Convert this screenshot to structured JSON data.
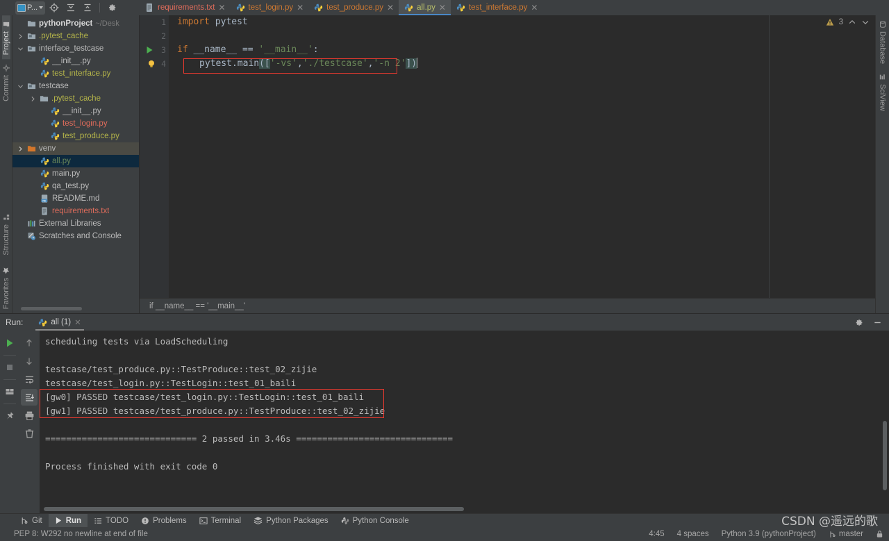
{
  "toolbar": {
    "project_selector_label": "P...",
    "buttons": [
      {
        "name": "project-selector",
        "label": "P..."
      },
      {
        "name": "locate-icon",
        "label": "Select Opened File"
      },
      {
        "name": "expand-all-icon",
        "label": "Expand All"
      },
      {
        "name": "collapse-all-icon",
        "label": "Collapse All"
      },
      {
        "name": "settings-gear-icon",
        "label": "Settings"
      }
    ]
  },
  "left_rail": {
    "top": "Project",
    "below": "Commit",
    "structure": "Structure",
    "favorites": "Favorites"
  },
  "right_rail": {
    "database": "Database",
    "sciview": "SciView"
  },
  "tabs": [
    {
      "label": "requirements.txt",
      "icon": "text-file-icon",
      "color": "red",
      "active": false
    },
    {
      "label": "test_login.py",
      "icon": "python-file-icon",
      "color": "orange",
      "active": false
    },
    {
      "label": "test_produce.py",
      "icon": "python-file-icon",
      "color": "orange",
      "active": false
    },
    {
      "label": "all.py",
      "icon": "python-file-icon",
      "color": "active",
      "active": true
    },
    {
      "label": "test_interface.py",
      "icon": "python-file-icon",
      "color": "orange",
      "active": false
    }
  ],
  "project_tree": [
    {
      "label": "pythonProject",
      "suffix": "~/Desk",
      "indent": 0,
      "arrow": "none",
      "icon": "folder-icon",
      "style": "bold",
      "selected": false
    },
    {
      "label": ".pytest_cache",
      "suffix": "",
      "indent": 1,
      "arrow": "right",
      "icon": "folder-module-icon",
      "style": "olive",
      "selected": false
    },
    {
      "label": "interface_testcase",
      "suffix": "",
      "indent": 1,
      "arrow": "down",
      "icon": "folder-module-icon",
      "style": "plain",
      "selected": false
    },
    {
      "label": "__init__.py",
      "suffix": "",
      "indent": 2,
      "arrow": "none",
      "icon": "python-file-icon",
      "style": "plain",
      "selected": false
    },
    {
      "label": "test_interface.py",
      "suffix": "",
      "indent": 2,
      "arrow": "none",
      "icon": "python-file-icon",
      "style": "olive",
      "selected": false
    },
    {
      "label": "testcase",
      "suffix": "",
      "indent": 1,
      "arrow": "down",
      "icon": "folder-module-icon",
      "style": "plain",
      "selected": false
    },
    {
      "label": ".pytest_cache",
      "suffix": "",
      "indent": 2,
      "arrow": "right",
      "icon": "folder-icon",
      "style": "olive",
      "selected": false
    },
    {
      "label": "__init__.py",
      "suffix": "",
      "indent": 3,
      "arrow": "none",
      "icon": "python-file-icon",
      "style": "plain",
      "selected": false
    },
    {
      "label": "test_login.py",
      "suffix": "",
      "indent": 3,
      "arrow": "none",
      "icon": "python-file-icon",
      "style": "red",
      "selected": false
    },
    {
      "label": "test_produce.py",
      "suffix": "",
      "indent": 3,
      "arrow": "none",
      "icon": "python-file-icon",
      "style": "olive",
      "selected": false
    },
    {
      "label": "venv",
      "suffix": "",
      "indent": 1,
      "arrow": "right",
      "icon": "folder-orange-icon",
      "style": "plain",
      "selected": false,
      "highlight": true
    },
    {
      "label": "all.py",
      "suffix": "",
      "indent": 2,
      "arrow": "none",
      "icon": "python-file-icon",
      "style": "green",
      "selected": true
    },
    {
      "label": "main.py",
      "suffix": "",
      "indent": 2,
      "arrow": "none",
      "icon": "python-file-icon",
      "style": "plain",
      "selected": false
    },
    {
      "label": "qa_test.py",
      "suffix": "",
      "indent": 2,
      "arrow": "none",
      "icon": "python-file-icon",
      "style": "plain",
      "selected": false
    },
    {
      "label": "README.md",
      "suffix": "",
      "indent": 2,
      "arrow": "none",
      "icon": "markdown-file-icon",
      "style": "plain",
      "selected": false
    },
    {
      "label": "requirements.txt",
      "suffix": "",
      "indent": 2,
      "arrow": "none",
      "icon": "text-file-icon",
      "style": "red",
      "selected": false
    },
    {
      "label": "External Libraries",
      "suffix": "",
      "indent": 0,
      "arrow": "none",
      "icon": "libraries-icon",
      "style": "plain",
      "selected": false
    },
    {
      "label": "Scratches and Console",
      "suffix": "",
      "indent": 0,
      "arrow": "none",
      "icon": "scratches-icon",
      "style": "plain",
      "selected": false
    }
  ],
  "editor": {
    "line_numbers": [
      "1",
      "2",
      "3",
      "4"
    ],
    "lines": [
      "import pytest",
      "",
      "if __name__ == '__main__':",
      "    pytest.main(['-vs','./testcase','-n 2'])"
    ],
    "code_tokens": {
      "l1_kw": "import",
      "l1_rest": " pytest",
      "l3_kw": "if",
      "l3_name": " __name__ ",
      "l3_eq": "== ",
      "l3_str": "'__main__'",
      "l3_colon": ":",
      "l4_obj": "pytest",
      "l4_dot": ".",
      "l4_fn": "main",
      "l4_open": "([",
      "l4_s1": "'-vs'",
      "l4_c1": ",",
      "l4_s2": "'./testcase'",
      "l4_c2": ",",
      "l4_s3": "'-n 2'",
      "l4_close": "])"
    },
    "warning_count": "3",
    "breadcrumb": "if __name__ == '__main__'"
  },
  "run_panel": {
    "label": "Run:",
    "tab_label": "all (1)",
    "console_lines": [
      "scheduling tests via LoadScheduling",
      "",
      "testcase/test_produce.py::TestProduce::test_02_zijie",
      "testcase/test_login.py::TestLogin::test_01_baili",
      "[gw0] PASSED testcase/test_login.py::TestLogin::test_01_baili",
      "[gw1] PASSED testcase/test_produce.py::TestProduce::test_02_zijie",
      "",
      "============================= 2 passed in 3.46s ==============================",
      "",
      "Process finished with exit code 0"
    ],
    "toolbar_icons": [
      "rerun-icon",
      "stop-icon",
      "toggle-tasks-icon",
      "pin-icon",
      "up-arrow-icon",
      "down-arrow-icon",
      "soft-wrap-icon",
      "scroll-to-end-icon",
      "print-icon",
      "trash-icon"
    ],
    "header_icons": [
      "settings-gear-icon",
      "minimize-icon"
    ]
  },
  "tool_window_bar": [
    {
      "label": "Git",
      "icon": "git-icon",
      "active": false
    },
    {
      "label": "Run",
      "icon": "run-icon",
      "active": true
    },
    {
      "label": "TODO",
      "icon": "todo-icon",
      "active": false
    },
    {
      "label": "Problems",
      "icon": "problems-icon",
      "active": false
    },
    {
      "label": "Terminal",
      "icon": "terminal-icon",
      "active": false
    },
    {
      "label": "Python Packages",
      "icon": "packages-icon",
      "active": false
    },
    {
      "label": "Python Console",
      "icon": "python-console-icon",
      "active": false
    }
  ],
  "status_bar": {
    "message": "PEP 8: W292 no newline at end of file",
    "caret_position": "4:45",
    "indent": "4 spaces",
    "interpreter": "Python 3.9 (pythonProject)",
    "branch": "master",
    "branch_icon": "vcs-branch-icon",
    "lock_icon": "lock-icon"
  },
  "watermark": "CSDN @遥远的歌",
  "colors": {
    "bg_panel": "#3c3f41",
    "bg_editor": "#2b2b2b",
    "accent_blue": "#4a88c7",
    "selection": "#0d293e",
    "red_box": "#e8392f",
    "string_green": "#6a8759",
    "keyword_orange": "#cc7832"
  }
}
